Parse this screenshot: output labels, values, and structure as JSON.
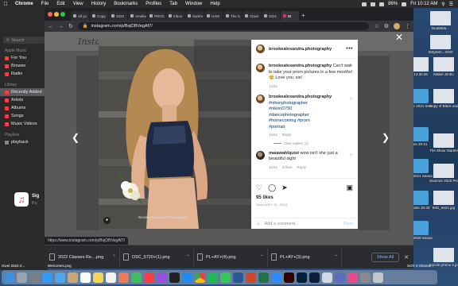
{
  "menubar": {
    "app": "Chrome",
    "items": [
      "File",
      "Edit",
      "View",
      "History",
      "Bookmarks",
      "Profiles",
      "Tab",
      "Window",
      "Help"
    ],
    "battery": "86%",
    "clock": "Fri 10:12 AM"
  },
  "music": {
    "search_placeholder": "Search",
    "section_apple_music": "Apple Music",
    "apple_music_items": [
      "For You",
      "Browse",
      "Radio"
    ],
    "section_library": "Library",
    "library_items": [
      "Recently Added",
      "Artists",
      "Albums",
      "Songs",
      "Music Videos"
    ],
    "section_playlists": "Playlists",
    "playlist_items": [
      "playback"
    ],
    "signin_title": "Sig",
    "signin_sub": "If y"
  },
  "tabs": [
    {
      "label": "All yo"
    },
    {
      "label": "Copy"
    },
    {
      "label": "2022"
    },
    {
      "label": "Amelia"
    },
    {
      "label": "PROC"
    },
    {
      "label": "Inbox"
    },
    {
      "label": "Summ"
    },
    {
      "label": "HAM"
    },
    {
      "label": "The S"
    },
    {
      "label": "Class"
    },
    {
      "label": "2021"
    },
    {
      "label": "Br"
    }
  ],
  "omnibox": {
    "url": "instagram.com/p/BsjOBVegAf7/"
  },
  "instagram": {
    "bg_logo": "Instagram",
    "username": "brookealexandra.photography",
    "more": "•••",
    "comments": [
      {
        "user": "brookealexandra.photography",
        "text": "Can't wait to take your prom pictures in a few months! 😊 Love you, sis!",
        "time": "124w"
      },
      {
        "user": "brookealexandra.photography",
        "tags": [
          "#nikonphotographer",
          "#nikonD750",
          "#dancephotographer",
          "#homecoming",
          "#prom",
          "#portrait"
        ],
        "time": "124w",
        "reply": "Reply"
      },
      {
        "user": "maiawahlquist",
        "text": "wow isn't she just a beautiful sight",
        "time": "124w",
        "likes": "3 likes",
        "reply": "Reply"
      }
    ],
    "view_replies": "View replies (1)",
    "likes": "95 likes",
    "date": "JANUARY 11, 2019",
    "add_comment_placeholder": "Add a comment...",
    "post_label": "Post",
    "photo_credit": "Brooke Alexandra Photography"
  },
  "hover_url": "https://www.instagram.com/p/BsjOBVegAf7/",
  "downloads": [
    {
      "name": "2022 Classes Re....png"
    },
    {
      "name": "DSC_5720+(1).png"
    },
    {
      "name": "PL+AY+(4).png"
    },
    {
      "name": "PL+AY+(3).png"
    }
  ],
  "downloads_show_all": "Show All",
  "desktop_icons": [
    {
      "label": "Boa50a5..."
    },
    {
      "label": "5Stylesh...2020"
    },
    {
      "label": "42 14:30.06"
    },
    {
      "label": "Mabel Jimbo"
    },
    {
      "label": "ummer 2021 Seasons"
    },
    {
      "label": "Copy of Black and White CA...g 2"
    },
    {
      "label": "isses 20-21"
    },
    {
      "label": "The Show Starters!.png"
    },
    {
      "label": "2020-2021 Season"
    },
    {
      "label": "Summer 2020 Promo 1 copy.jpg"
    },
    {
      "label": "Classes 19-20"
    },
    {
      "label": "IMG_6621.jpg"
    },
    {
      "label": "2019-2020 Season"
    },
    {
      "label": "amelie promo 1.jpg"
    }
  ],
  "desktop_bottom": [
    "Givel 2022-2...",
    "Welcomes.png",
    "SCR-3 Shared..."
  ]
}
